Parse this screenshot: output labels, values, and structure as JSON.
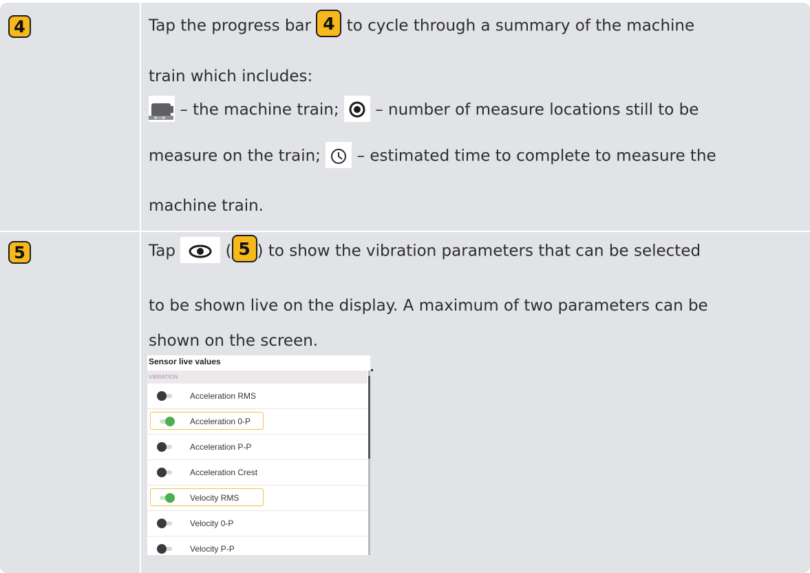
{
  "row4": {
    "badge": "4",
    "line1_pre": "Tap the progress bar",
    "line1_badge": "4",
    "line1_post": "to cycle through a summary of the machine",
    "line2": "train which includes:",
    "line3_a": "– the machine train;",
    "line3_b": "– number of measure locations still to be",
    "line4_a": "measure on the train;",
    "line4_b": "– estimated time to complete to measure the",
    "line5": "machine train."
  },
  "row5": {
    "badge": "5",
    "line1_pre": "Tap",
    "line1_paren_open": "(",
    "line1_badge": "5",
    "line1_post": ") to show the vibration parameters that can be selected",
    "line2": "to be shown live on the display. A maximum of two parameters can be",
    "line3": "shown on the screen.",
    "panel": {
      "title": "Sensor live values",
      "section": "VIBRATION",
      "items": [
        {
          "label": "Acceleration RMS",
          "enabled": false
        },
        {
          "label": "Acceleration 0-P",
          "enabled": true
        },
        {
          "label": "Acceleration P-P",
          "enabled": false
        },
        {
          "label": "Acceleration Crest",
          "enabled": false
        },
        {
          "label": "Velocity RMS",
          "enabled": true
        },
        {
          "label": "Velocity 0-P",
          "enabled": false
        },
        {
          "label": "Velocity P-P",
          "enabled": false
        }
      ]
    }
  },
  "colors": {
    "badge_fill": "#f7b81b",
    "table_bg": "#e1e3e7",
    "toggle_on": "#4cae4f",
    "highlight": "#f2c14b"
  },
  "icons": [
    "machine-train-icon",
    "measure-location-icon",
    "clock-icon",
    "eye-icon"
  ]
}
